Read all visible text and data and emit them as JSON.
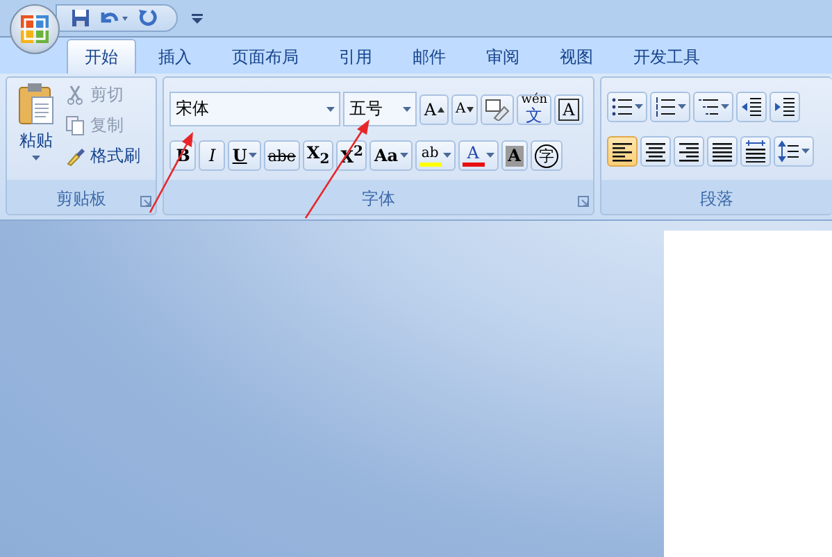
{
  "tabs": [
    {
      "label": "开始",
      "selected": true
    },
    {
      "label": "插入",
      "selected": false
    },
    {
      "label": "页面布局",
      "selected": false
    },
    {
      "label": "引用",
      "selected": false
    },
    {
      "label": "邮件",
      "selected": false
    },
    {
      "label": "审阅",
      "selected": false
    },
    {
      "label": "视图",
      "selected": false
    },
    {
      "label": "开发工具",
      "selected": false
    }
  ],
  "clipboard": {
    "title": "剪贴板",
    "paste": {
      "label": "粘贴"
    },
    "items": [
      {
        "kind": "cut",
        "label": "剪切",
        "disabled": true
      },
      {
        "kind": "copy",
        "label": "复制",
        "disabled": true
      },
      {
        "kind": "brush",
        "label": "格式刷",
        "disabled": false
      }
    ]
  },
  "font": {
    "title": "字体",
    "font_name": {
      "value": "宋体"
    },
    "font_size": {
      "value": "五号"
    },
    "row_1": [
      {
        "kind": "grow",
        "label": "A"
      },
      {
        "kind": "shrink",
        "label": "A"
      },
      {
        "kind": "clear"
      },
      {
        "kind": "phonetic",
        "label": "wén",
        "label_2": "文"
      },
      {
        "kind": "border",
        "label": "A"
      }
    ],
    "row_2": [
      {
        "kind": "bold",
        "label": "B"
      },
      {
        "kind": "italic",
        "label": "I"
      },
      {
        "kind": "underline",
        "label": "U",
        "dropdown": true
      },
      {
        "kind": "strike",
        "label": "abe"
      },
      {
        "kind": "letter",
        "label": "X$_{2}$"
      },
      {
        "kind": "letter",
        "label": "X$^{2}$"
      },
      {
        "kind": "letter",
        "label": "Aa",
        "dropdown": true
      },
      {
        "kind": "highlight",
        "label": "ab",
        "dropdown": true
      },
      {
        "kind": "font-color",
        "label": "A",
        "dropdown": true
      },
      {
        "kind": "shading",
        "label": "A"
      },
      {
        "kind": "enclose",
        "label": "字"
      }
    ]
  },
  "paragraph": {
    "title": "段落",
    "row_1": [
      {
        "kind": "bullets",
        "dropdown": true
      },
      {
        "kind": "numbering",
        "dropdown": true
      },
      {
        "kind": "multilevel",
        "dropdown": true
      },
      {
        "kind": "outdent"
      },
      {
        "kind": "indent"
      }
    ],
    "row_2": [
      {
        "kind": "align-left",
        "selected": true
      },
      {
        "kind": "align-center",
        "selected": false
      },
      {
        "kind": "align-right",
        "selected": false
      },
      {
        "kind": "justify",
        "selected": false
      },
      {
        "kind": "distribute",
        "selected": false
      },
      {
        "kind": "line-spacing",
        "dropdown": true
      }
    ]
  }
}
